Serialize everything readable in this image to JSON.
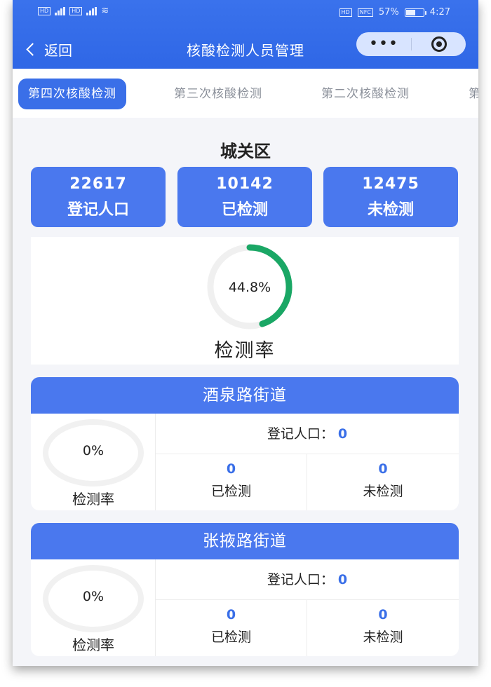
{
  "status_bar": {
    "left_tags": [
      "HD",
      "HD"
    ],
    "right_tags": [
      "HD",
      "NFC"
    ],
    "battery": "57%",
    "time": "4:27"
  },
  "nav": {
    "back_label": "返回",
    "title": "核酸检测人员管理",
    "more_glyph": "•••",
    "icons": [
      "chevron-left",
      "more-dots",
      "target-circle"
    ]
  },
  "tabs": [
    {
      "label": "第四次核酸检测",
      "active": true
    },
    {
      "label": "第三次核酸检测",
      "active": false
    },
    {
      "label": "第二次核酸检测",
      "active": false
    },
    {
      "label": "第",
      "active": false
    }
  ],
  "district": {
    "name": "城关区",
    "stats": [
      {
        "value": "22617",
        "label": "登记人口"
      },
      {
        "value": "10142",
        "label": "已检测"
      },
      {
        "value": "12475",
        "label": "未检测"
      }
    ],
    "rate_text": "44.8%",
    "rate_value": 44.8,
    "rate_label": "检测率"
  },
  "streets": [
    {
      "name": "酒泉路街道",
      "rate_text": "0%",
      "rate_label": "检测率",
      "registered_label": "登记人口：",
      "registered_value": "0",
      "tested_value": "0",
      "tested_label": "已检测",
      "untested_value": "0",
      "untested_label": "未检测"
    },
    {
      "name": "张掖路街道",
      "rate_text": "0%",
      "rate_label": "检测率",
      "registered_label": "登记人口：",
      "registered_value": "0",
      "tested_value": "0",
      "tested_label": "已检测",
      "untested_value": "0",
      "untested_label": "未检测"
    }
  ],
  "colors": {
    "primary": "#3a6fe8",
    "card": "#4a78ee",
    "progress": "#1aa765",
    "track": "#f0f0f0"
  }
}
